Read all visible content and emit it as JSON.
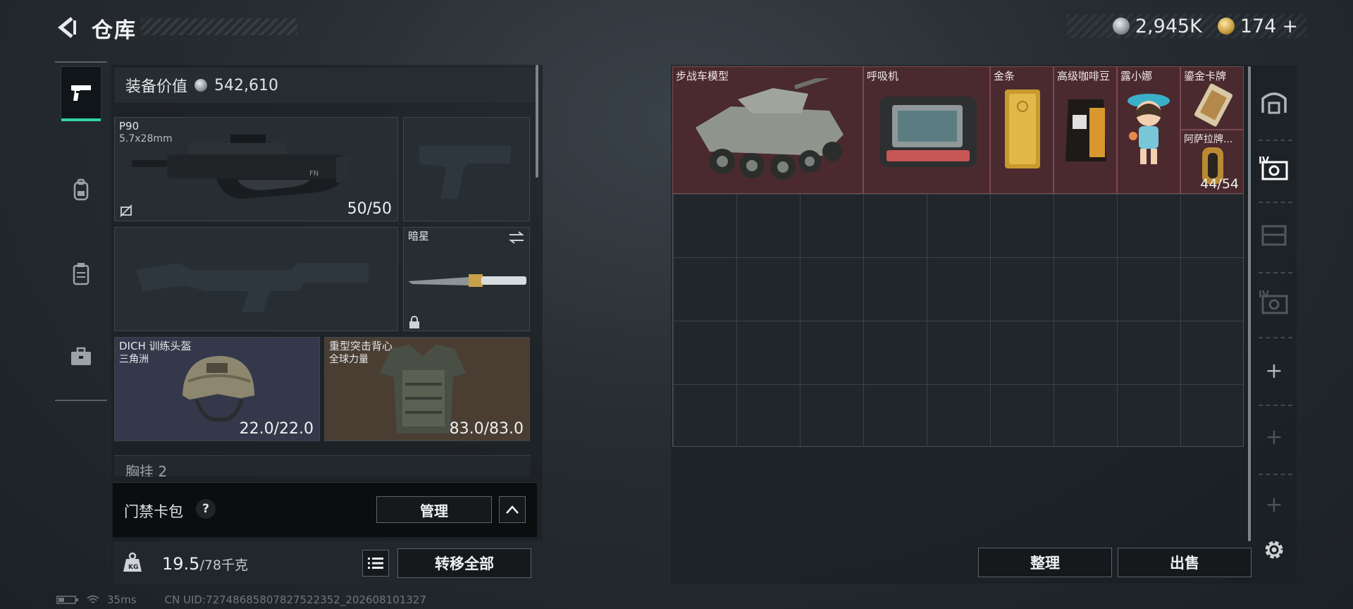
{
  "header": {
    "title": "仓库",
    "currency_silver": "2,945K",
    "currency_gold": "174",
    "currency_gold_plus": "+"
  },
  "equipment": {
    "value_label": "装备价值",
    "value": "542,610",
    "primary_weapon": {
      "name": "P90",
      "caliber": "5.7x28mm",
      "ammo": "50/50"
    },
    "melee": {
      "name": "暗星"
    },
    "helmet": {
      "name": "DICH 训练头盔",
      "faction": "三角洲",
      "durability": "22.0/22.0"
    },
    "armor": {
      "name": "重型突击背心",
      "faction": "全球力量",
      "durability": "83.0/83.0"
    },
    "chest_rig_label": "胸挂 2"
  },
  "keycard": {
    "label": "门禁卡包",
    "help": "?",
    "manage_label": "管理"
  },
  "weight": {
    "current": "19.5",
    "max": "/78千克",
    "transfer_all_label": "转移全部"
  },
  "storage": {
    "items": [
      {
        "name": "步战车模型"
      },
      {
        "name": "呼吸机"
      },
      {
        "name": "金条"
      },
      {
        "name": "高级咖啡豆"
      },
      {
        "name": "露小娜"
      },
      {
        "name": "鎏金卡牌"
      },
      {
        "name": "阿萨拉牌...",
        "qty": "44/54"
      }
    ],
    "sort_label": "整理",
    "sell_label": "出售"
  },
  "status": {
    "ping": "35ms",
    "uid": "CN UID:7274868580782752​2352_202608101327"
  },
  "colors": {
    "accent": "#2fd3a6",
    "item_bg": "#4a2a2f",
    "helmet_bg": "#34384a",
    "armor_bg": "#4a3e33"
  }
}
